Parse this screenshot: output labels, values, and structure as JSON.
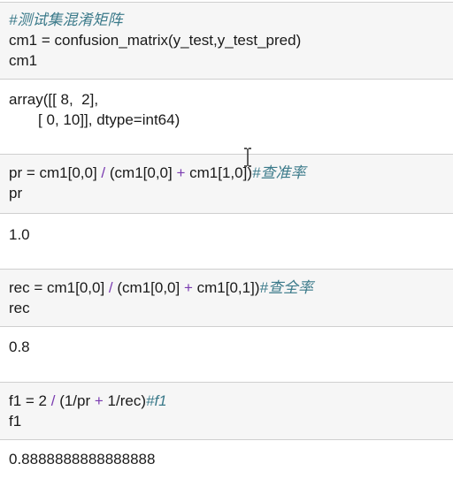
{
  "cells": [
    {
      "code": {
        "line1_comment": "#测试集混淆矩阵",
        "line2": "cm1 = confusion_matrix(y_test,y_test_pred)",
        "line3": "cm1"
      },
      "output": {
        "line1": "array([[ 8,  2],",
        "line2": "       [ 0, 10]], dtype=int64)"
      }
    },
    {
      "code": {
        "line1_a": "pr = cm1[0,0] ",
        "line1_op1": "/",
        "line1_b": " (cm1[0,0] ",
        "line1_op2": "+",
        "line1_c": " cm1[1,0])",
        "line1_comment": "#查准率",
        "line2": "pr"
      },
      "output": {
        "line1": "1.0"
      }
    },
    {
      "code": {
        "line1_a": "rec = cm1[0,0] ",
        "line1_op1": "/",
        "line1_b": " (cm1[0,0] ",
        "line1_op2": "+",
        "line1_c": " cm1[0,1])",
        "line1_comment": "#查全率",
        "line2": "rec"
      },
      "output": {
        "line1": "0.8"
      }
    },
    {
      "code": {
        "line1_a": "f1 = 2 ",
        "line1_op1": "/",
        "line1_b": " (1/pr ",
        "line1_op2": "+",
        "line1_c": " 1/rec)",
        "line1_comment": "#f1",
        "line2": "f1"
      },
      "output": {
        "line1": "0.8888888888888888"
      }
    }
  ],
  "colors": {
    "code_background": "#f6f6f6",
    "comment": "#3b7a8a",
    "operator": "#7a3bb0",
    "text": "#1a1a1a"
  }
}
